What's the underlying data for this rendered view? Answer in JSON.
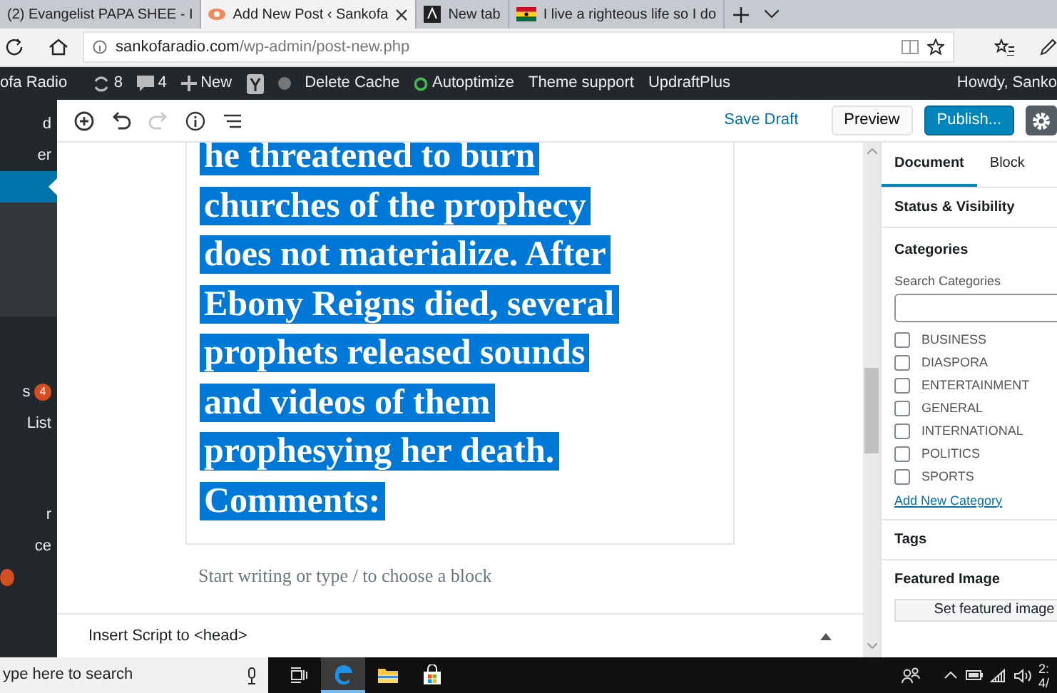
{
  "browser": {
    "tabs": [
      {
        "title": "(2) Evangelist PAPA SHEE - I",
        "selected": false,
        "kind": "plain"
      },
      {
        "title": "Add New Post ‹ Sankofa",
        "selected": true,
        "kind": "favicon"
      },
      {
        "title": "New tab",
        "selected": false,
        "kind": "page"
      },
      {
        "title": "I live a righteous life so I do",
        "selected": false,
        "kind": "flag"
      }
    ],
    "address": {
      "host": "sankofaradio.com",
      "path": "/wp-admin/post-new.php"
    }
  },
  "admin_bar": {
    "site": "ofa Radio",
    "updates": "8",
    "comments": "4",
    "new": "New",
    "items": [
      {
        "label": "Delete Cache",
        "kind": "text"
      },
      {
        "label": "Autoptimize",
        "kind": "status"
      },
      {
        "label": "Theme support",
        "kind": "text"
      },
      {
        "label": "UpdraftPlus",
        "kind": "text"
      }
    ],
    "greeting": "Howdy, Sanko"
  },
  "sidebar": {
    "items": [
      {
        "label": "d",
        "selected": false
      },
      {
        "label": "er",
        "selected": false
      },
      {
        "selected": true
      },
      {
        "kind": "submenu"
      },
      {
        "label": "s",
        "badge": "4",
        "selected": false
      },
      {
        "label": "List",
        "selected": false
      },
      {
        "label": "r",
        "selected": false
      },
      {
        "label": "ce",
        "selected": false
      },
      {
        "kind": "badge-only",
        "selected": false
      }
    ]
  },
  "toolbar": {
    "tools": [
      {
        "kind": "add",
        "disabled": false
      },
      {
        "kind": "undo",
        "disabled": false
      },
      {
        "kind": "redo",
        "disabled": true
      },
      {
        "kind": "info",
        "disabled": false
      },
      {
        "kind": "outline",
        "disabled": false
      }
    ],
    "save_draft": "Save Draft",
    "preview": "Preview",
    "publish": "Publish...",
    "settings_active": true
  },
  "content": {
    "paragraph_lines": [
      "he threatened to burn",
      "churches of the prophecy",
      "does not materialize. After",
      "Ebony Reigns died, several",
      "prophets released sounds",
      "and videos of them",
      "prophesying her death.",
      "Comments:"
    ],
    "selected": true,
    "placeholder": "Start writing or type / to choose a block"
  },
  "meta_box": {
    "title": "Insert Script to <head>"
  },
  "panel": {
    "tabs": [
      {
        "label": "Document",
        "selected": true
      },
      {
        "label": "Block",
        "selected": false
      }
    ],
    "status_visibility": "Status & Visibility",
    "categories": {
      "title": "Categories",
      "search_label": "Search Categories",
      "items": [
        {
          "label": "BUSINESS",
          "checked": false
        },
        {
          "label": "DIASPORA",
          "checked": false
        },
        {
          "label": "ENTERTAINMENT",
          "checked": false
        },
        {
          "label": "GENERAL",
          "checked": false
        },
        {
          "label": "INTERNATIONAL",
          "checked": false
        },
        {
          "label": "POLITICS",
          "checked": false
        },
        {
          "label": "SPORTS",
          "checked": false
        }
      ],
      "add_link": "Add New Category"
    },
    "tags": "Tags",
    "featured_image": "Featured Image",
    "set_featured": "Set featured image"
  },
  "taskbar": {
    "search_placeholder": "ype here to search",
    "apps": [
      {
        "kind": "edge",
        "active": true
      },
      {
        "kind": "folder",
        "active": false
      },
      {
        "kind": "store",
        "active": false
      }
    ],
    "clock": [
      "2:",
      "4/"
    ]
  }
}
